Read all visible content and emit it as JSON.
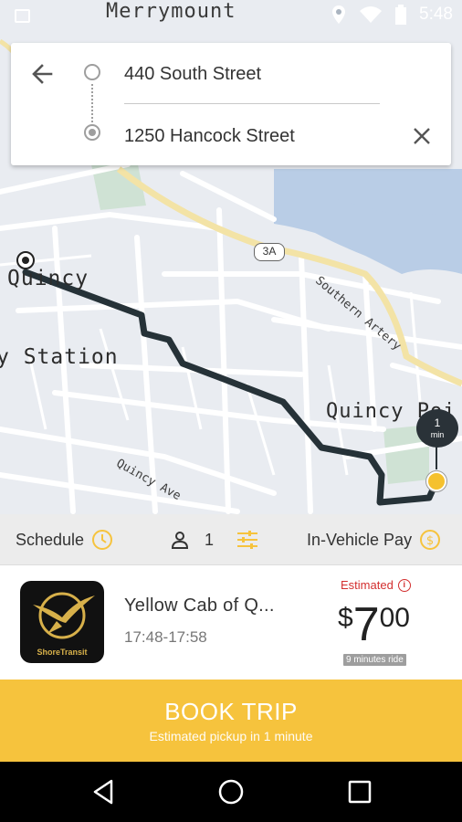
{
  "status_bar": {
    "time": "5:48",
    "icons": [
      "photo-icon",
      "location-icon",
      "wifi-icon",
      "battery-icon"
    ]
  },
  "map": {
    "labels": {
      "merrymount": "Merrymount",
      "quincy": "Quincy",
      "station": "y Station",
      "quincy_point": "Quincy Poi",
      "southern_artery": "Southern Artery",
      "quincy_ave": "Quincy Ave",
      "route_shield": "3A"
    },
    "eta": {
      "value": "1",
      "unit": "min"
    },
    "colors": {
      "route": "#263238",
      "water": "#b9cde6",
      "highway": "#f3e3a6",
      "pickup": "#f5c12e"
    }
  },
  "address": {
    "origin": "440 South Street",
    "destination": "1250 Hancock Street"
  },
  "options": {
    "schedule_label": "Schedule",
    "passenger_count": "1",
    "payment_label": "In-Vehicle Pay"
  },
  "ride": {
    "provider_name": "Yellow Cab of Q...",
    "logo_text": "ShoreTransit",
    "time_window": "17:48-17:58",
    "estimated_label": "Estimated",
    "price": {
      "currency": "$",
      "dollars": "7",
      "cents": "00"
    },
    "duration": "9 minutes ride"
  },
  "book_trip": {
    "label": "BOOK TRIP",
    "subtitle": "Estimated pickup in 1 minute",
    "color": "#f6c33d"
  },
  "nav": {
    "buttons": [
      "back-triangle-icon",
      "home-circle-icon",
      "recents-square-icon"
    ]
  }
}
